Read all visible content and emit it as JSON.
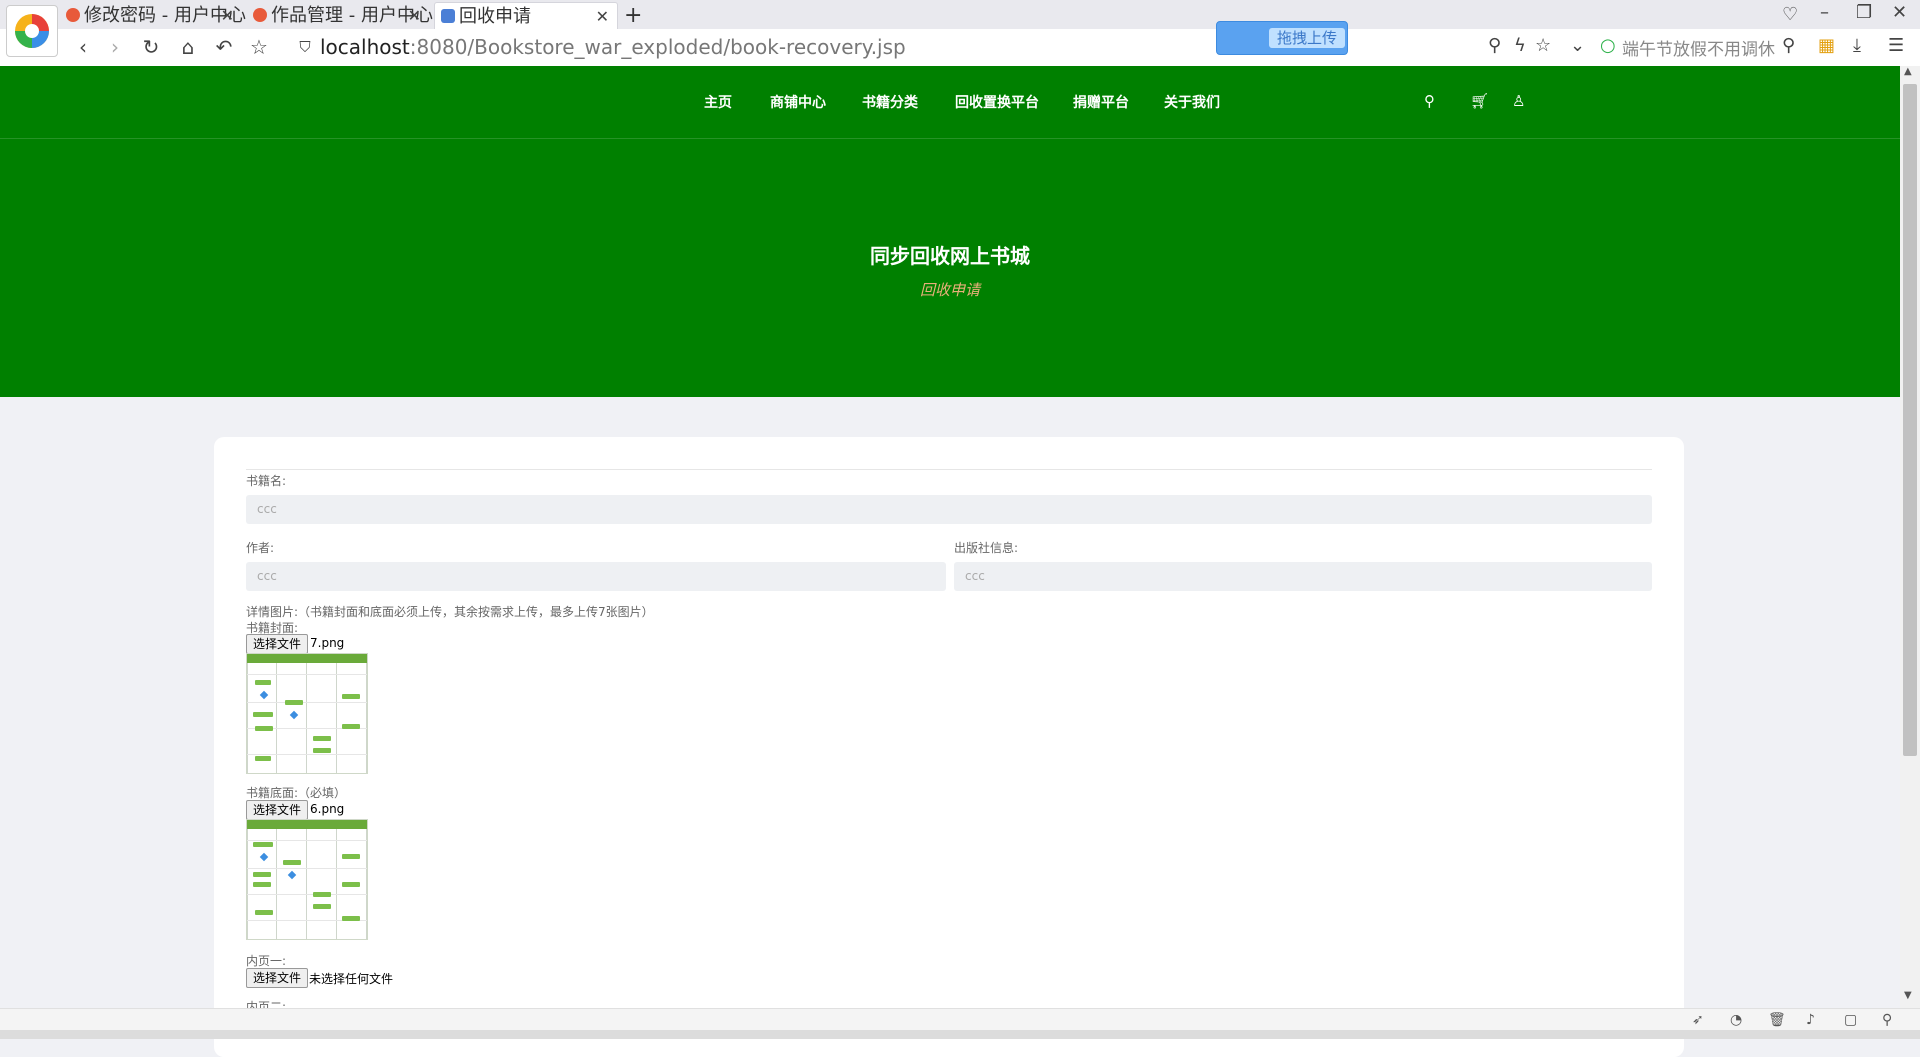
{
  "browser": {
    "tabs": [
      {
        "label": "修改密码 - 用户中心",
        "active": false
      },
      {
        "label": "作品管理 - 用户中心",
        "active": false
      },
      {
        "label": "回收申请",
        "active": true
      }
    ],
    "new_tab": "+",
    "url_host": "localhost",
    "url_rest": ":8080/Bookstore_war_exploded/book-recovery.jsp",
    "upload_button": "拖拽上传",
    "search_placeholder": "端午节放假不用调休"
  },
  "nav": {
    "items": [
      "主页",
      "商铺中心",
      "书籍分类",
      "回收置换平台",
      "捐赠平台",
      "关于我们"
    ]
  },
  "hero": {
    "title": "同步回收网上书城",
    "subtitle": "回收申请"
  },
  "form": {
    "book_name_label": "书籍名:",
    "book_name_value": "ccc",
    "author_label": "作者:",
    "author_value": "ccc",
    "publisher_label": "出版社信息:",
    "publisher_value": "ccc",
    "images_label": "详情图片:（书籍封面和底面必须上传，其余按需求上传，最多上传7张图片）",
    "cover_label": "书籍封面:",
    "cover_button": "选择文件",
    "cover_file": "7.png",
    "back_label": "书籍底面:（必填）",
    "back_button": "选择文件",
    "back_file": "6.png",
    "inner1_label": "内页一:",
    "inner1_button": "选择文件",
    "inner1_file": "未选择任何文件",
    "inner2_label": "内页二:"
  },
  "colors": {
    "header_green": "#008000",
    "subtitle": "#e8b07a",
    "page_bg": "#f0f1f5"
  }
}
